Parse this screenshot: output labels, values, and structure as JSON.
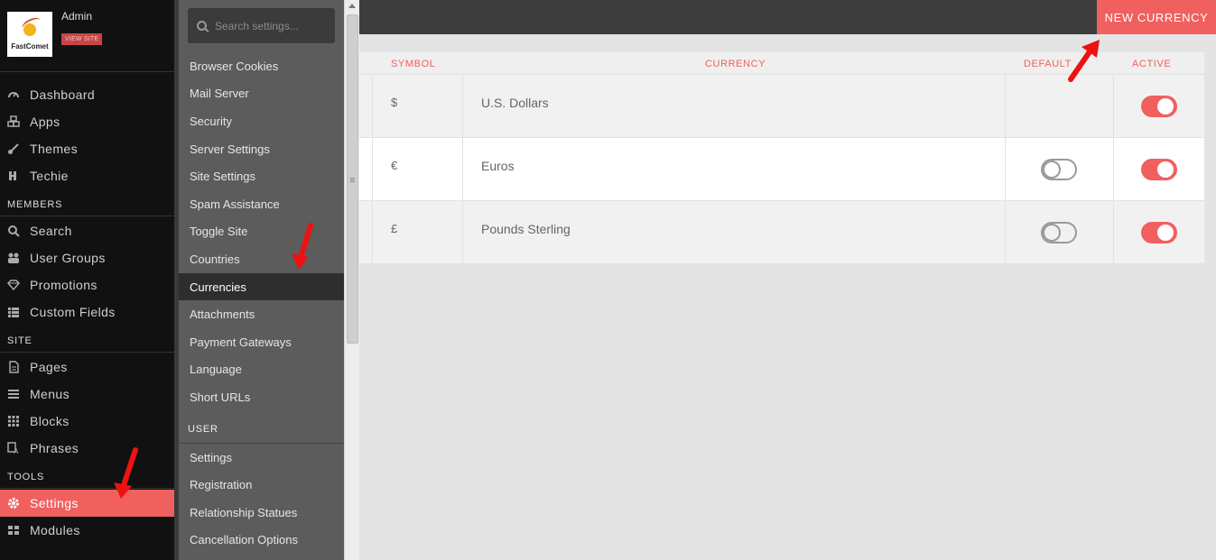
{
  "brand": {
    "logo_text": "FastComet",
    "admin_label": "Admin",
    "view_site_label": "VIEW SITE"
  },
  "sidebar": {
    "main_items": [
      {
        "label": "Dashboard",
        "icon": "speedometer-icon"
      },
      {
        "label": "Apps",
        "icon": "cubes-icon"
      },
      {
        "label": "Themes",
        "icon": "brush-icon"
      },
      {
        "label": "Techie",
        "icon": "code-icon"
      }
    ],
    "members_heading": "MEMBERS",
    "members_items": [
      {
        "label": "Search",
        "icon": "search-icon"
      },
      {
        "label": "User Groups",
        "icon": "users-icon"
      },
      {
        "label": "Promotions",
        "icon": "diamond-icon"
      },
      {
        "label": "Custom Fields",
        "icon": "list-icon"
      }
    ],
    "site_heading": "SITE",
    "site_items": [
      {
        "label": "Pages",
        "icon": "page-icon"
      },
      {
        "label": "Menus",
        "icon": "menu-icon"
      },
      {
        "label": "Blocks",
        "icon": "grid-icon"
      },
      {
        "label": "Phrases",
        "icon": "phrases-icon"
      }
    ],
    "tools_heading": "TOOLS",
    "tools_items": [
      {
        "label": "Settings",
        "icon": "gear-icon",
        "active": true
      },
      {
        "label": "Modules",
        "icon": "modules-icon"
      }
    ]
  },
  "subnav": {
    "search_placeholder": "Search settings...",
    "items": [
      "Browser Cookies",
      "Mail Server",
      "Security",
      "Server Settings",
      "Site Settings",
      "Spam Assistance",
      "Toggle Site",
      "Countries",
      "Currencies",
      "Attachments",
      "Payment Gateways",
      "Language",
      "Short URLs"
    ],
    "active_item": "Currencies",
    "user_heading": "USER",
    "user_items": [
      "Settings",
      "Registration",
      "Relationship Statues",
      "Cancellation Options"
    ]
  },
  "toolbar": {
    "new_currency_label": "NEW CURRENCY"
  },
  "table": {
    "headers": {
      "symbol": "SYMBOL",
      "currency": "CURRENCY",
      "default": "DEFAULT",
      "active": "ACTIVE"
    },
    "rows": [
      {
        "symbol": "$",
        "currency": "U.S. Dollars",
        "is_default": true,
        "active": true
      },
      {
        "symbol": "€",
        "currency": "Euros",
        "is_default": false,
        "active": true
      },
      {
        "symbol": "£",
        "currency": "Pounds Sterling",
        "is_default": false,
        "active": true
      }
    ]
  },
  "colors": {
    "accent": "#f0605e",
    "sidebar_bg": "#111111",
    "subnav_bg": "#5c5c5c",
    "topbar_bg": "#3d3d3d",
    "annotation_arrow": "#ee1111"
  }
}
